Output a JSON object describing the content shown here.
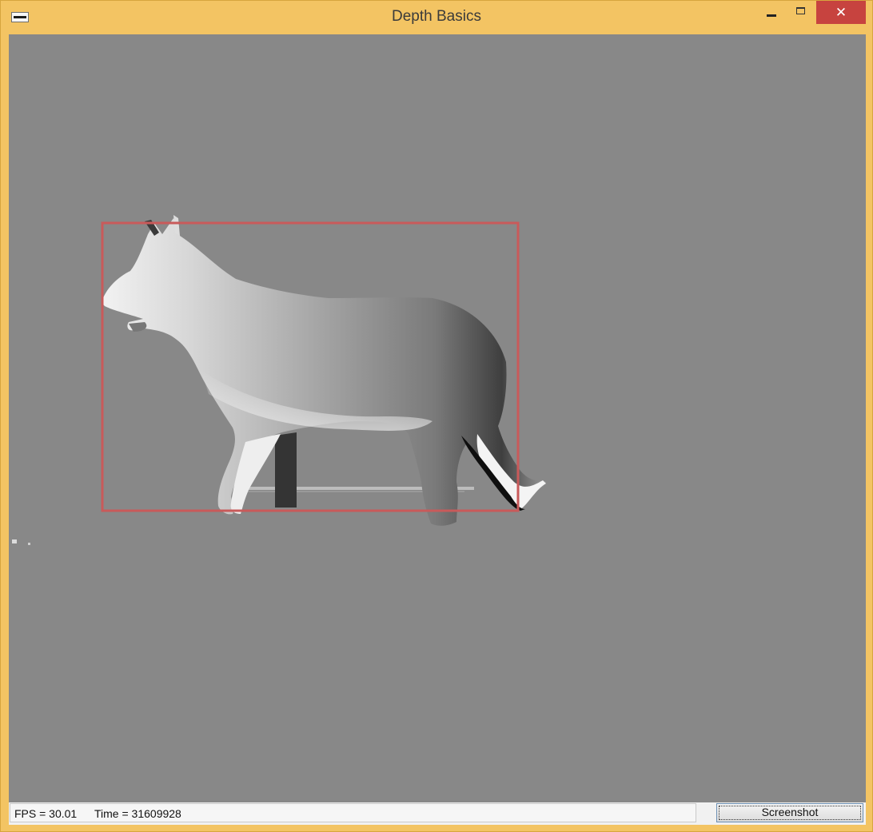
{
  "window": {
    "title": "Depth Basics",
    "close_glyph": "✕",
    "icons": [
      "app-icon",
      "minimize-icon",
      "maximize-icon",
      "close-icon"
    ]
  },
  "status": {
    "fps": "FPS = 30.01",
    "time": "Time = 31609928"
  },
  "toolbar": {
    "screenshot_label": "Screenshot"
  },
  "colors": {
    "title_bar": "#f3c463",
    "client_background": "#888888",
    "bounding_box": "#c95a5a",
    "close_button": "#c7433f"
  }
}
